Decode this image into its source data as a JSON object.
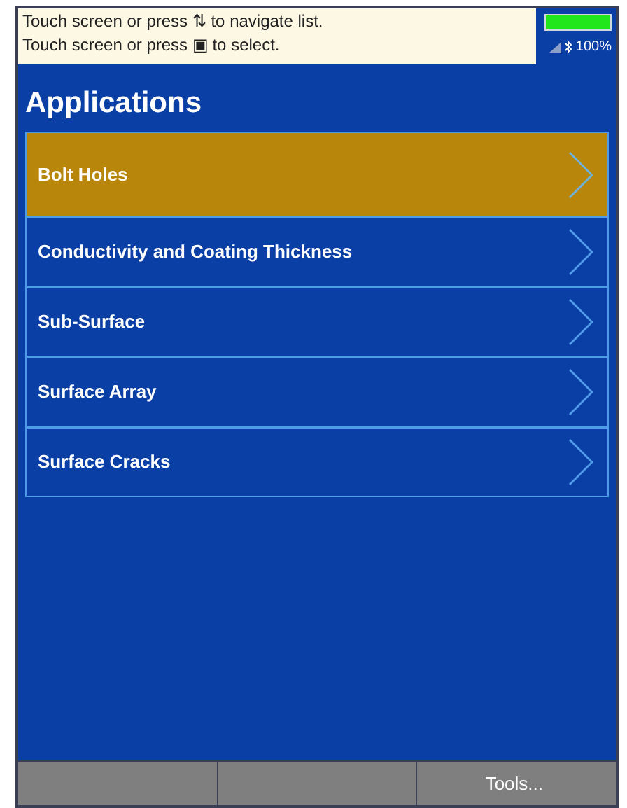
{
  "hints": [
    "Touch screen or press ⇅ to navigate list.",
    "Touch screen or press ▣ to select."
  ],
  "status": {
    "battery": {
      "level": 1.0
    },
    "battery_text": "100%"
  },
  "title": "Applications",
  "items": [
    {
      "label": "Bolt Holes",
      "selected": true
    },
    {
      "label": "Conductivity and Coating Thickness",
      "selected": false
    },
    {
      "label": "Sub-Surface",
      "selected": false
    },
    {
      "label": "Surface Array",
      "selected": false
    },
    {
      "label": "Surface Cracks",
      "selected": false
    }
  ],
  "softkeys": [
    {
      "kind": "blank"
    },
    {
      "kind": "blank"
    },
    {
      "kind": "labeled",
      "label": "Tools..."
    }
  ]
}
